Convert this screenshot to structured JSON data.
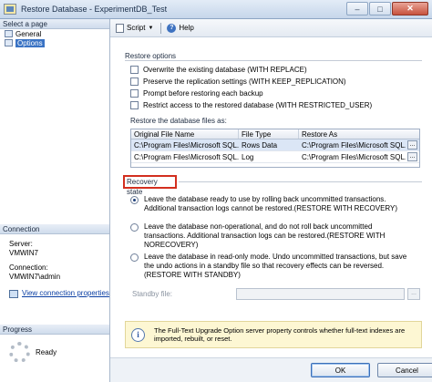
{
  "window": {
    "title": "Restore Database - ExperimentDB_Test"
  },
  "left": {
    "select_page": "Select a page",
    "pages": [
      {
        "label": "General"
      },
      {
        "label": "Options"
      }
    ],
    "connection_header": "Connection",
    "server_label": "Server:",
    "server_value": "VMWIN7",
    "connection_label": "Connection:",
    "connection_value": "VMWIN7\\admin",
    "view_connection_link": "View connection properties",
    "progress_header": "Progress",
    "progress_status": "Ready"
  },
  "toolbar": {
    "script_label": "Script",
    "help_label": "Help"
  },
  "restore_options": {
    "label": "Restore options",
    "checks": [
      "Overwrite the existing database (WITH REPLACE)",
      "Preserve the replication settings (WITH KEEP_REPLICATION)",
      "Prompt before restoring each backup",
      "Restrict access to the restored database (WITH RESTRICTED_USER)"
    ]
  },
  "files": {
    "label": "Restore the database files as:",
    "columns": [
      "Original File Name",
      "File Type",
      "Restore As"
    ],
    "rows": [
      [
        "C:\\Program Files\\Microsoft SQL...",
        "Rows Data",
        "C:\\Program Files\\Microsoft SQL..."
      ],
      [
        "C:\\Program Files\\Microsoft SQL...",
        "Log",
        "C:\\Program Files\\Microsoft SQL..."
      ]
    ],
    "browse_label": "..."
  },
  "recovery": {
    "label": "Recovery state",
    "options": [
      {
        "text": "Leave the database ready to use by rolling back uncommitted transactions. Additional transaction logs cannot be restored.(RESTORE WITH RECOVERY)",
        "selected": true
      },
      {
        "text": "Leave the database non-operational, and do not roll back uncommitted transactions. Additional transaction logs can be restored.(RESTORE WITH NORECOVERY)",
        "selected": false
      },
      {
        "text": "Leave the database in read-only mode. Undo uncommitted transactions, but save the undo actions in a standby file so that recovery effects can be reversed.(RESTORE WITH STANDBY)",
        "selected": false
      }
    ],
    "standby_label": "Standby file:",
    "standby_browse": "..."
  },
  "info": {
    "icon": "info-icon",
    "text": "The Full-Text Upgrade Option server property controls whether full-text indexes are imported, rebuilt, or reset."
  },
  "footer": {
    "ok_label": "OK",
    "cancel_label": "Cancel"
  },
  "colors": {
    "accent": "#3a73c4",
    "highlight_border": "#d32f1f",
    "info_bg": "#fdf7d3"
  }
}
